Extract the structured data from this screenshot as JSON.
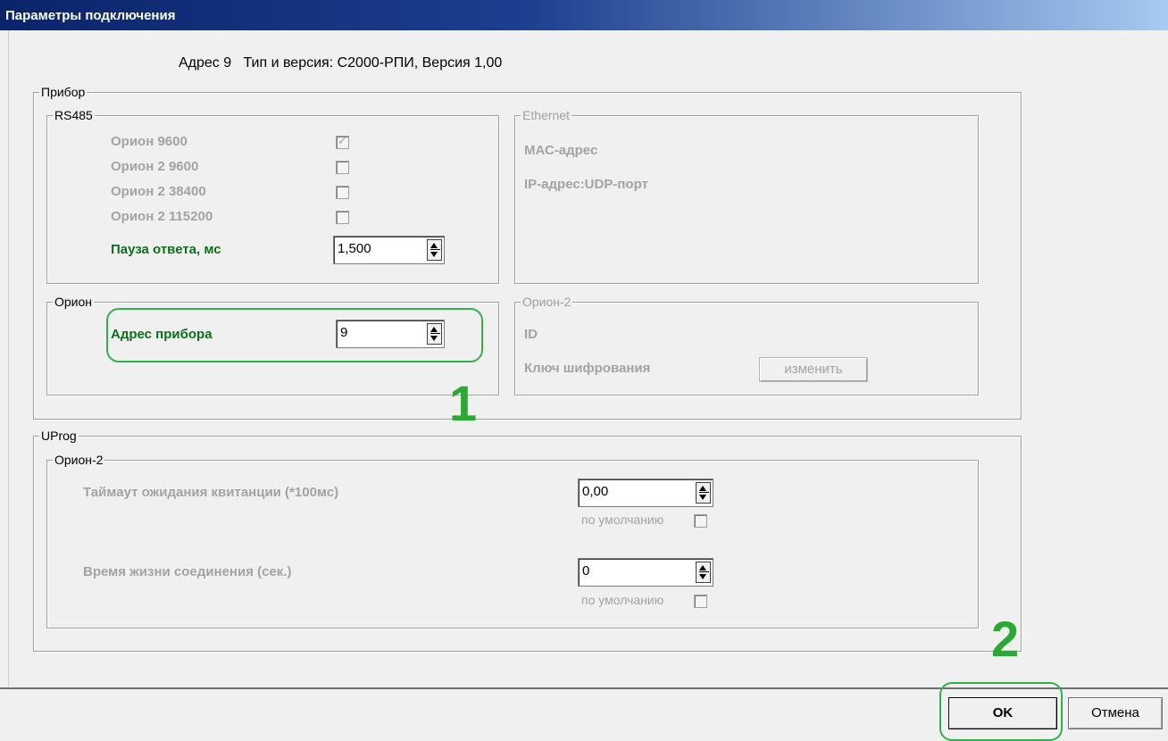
{
  "window": {
    "title": "Параметры подключения"
  },
  "header": {
    "text": "Адрес 9   Тип и версия: С2000-РПИ, Версия 1,00"
  },
  "device": {
    "legend": "Прибор",
    "rs485": {
      "legend": "RS485",
      "options": [
        {
          "label": "Орион 9600",
          "checked": true
        },
        {
          "label": "Орион 2 9600",
          "checked": false
        },
        {
          "label": "Орион 2 38400",
          "checked": false
        },
        {
          "label": "Орион 2 115200",
          "checked": false
        }
      ],
      "pause_label": "Пауза ответа, мс",
      "pause_value": "1,500"
    },
    "ethernet": {
      "legend": "Ethernet",
      "mac_label": "МАС-адрес",
      "ip_label": "IP-адрес:UDP-порт"
    },
    "orion": {
      "legend": "Орион",
      "address_label": "Адрес прибора",
      "address_value": "9"
    },
    "orion2": {
      "legend": "Орион-2",
      "id_label": "ID",
      "key_label": "Ключ шифрования",
      "change_button": "изменить"
    }
  },
  "uprog": {
    "legend": "UProg",
    "orion2": {
      "legend": "Орион-2",
      "timeout_label": "Таймаут ожидания квитанции (*100мс)",
      "timeout_value": "0,00",
      "timeout_default_label": "по умолчанию",
      "lifetime_label": "Время жизни соединения (сек.)",
      "lifetime_value": "0",
      "lifetime_default_label": "по умолчанию"
    }
  },
  "annotations": {
    "marker1": "1",
    "marker2": "2",
    "color": "#2aaa33"
  },
  "footer": {
    "ok": "OK",
    "cancel": "Отмена"
  }
}
